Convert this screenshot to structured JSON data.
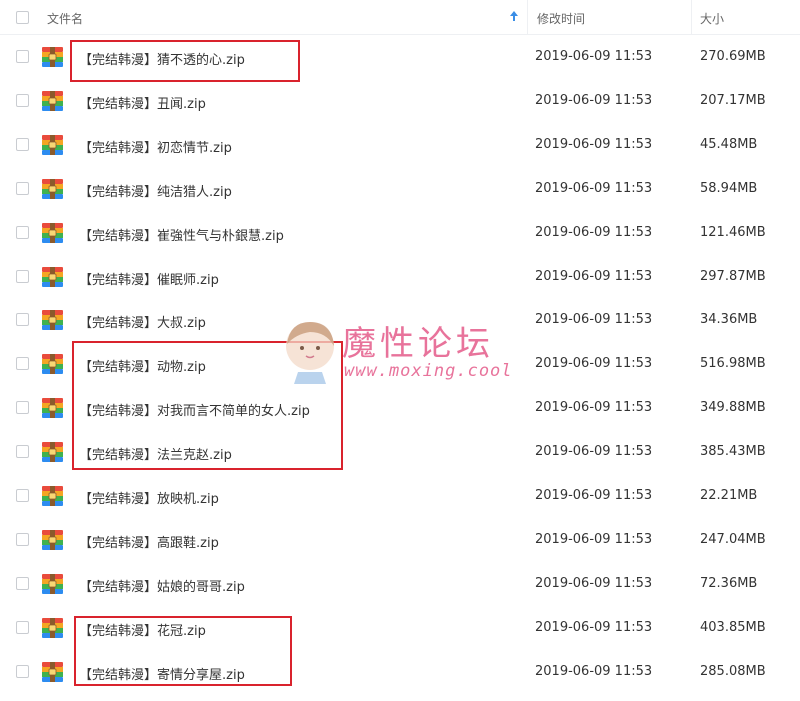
{
  "header": {
    "name_label": "文件名",
    "date_label": "修改时间",
    "size_label": "大小"
  },
  "files": [
    {
      "name": "【完结韩漫】猜不透的心.zip",
      "date": "2019-06-09 11:53",
      "size": "270.69MB"
    },
    {
      "name": "【完结韩漫】丑闻.zip",
      "date": "2019-06-09 11:53",
      "size": "207.17MB"
    },
    {
      "name": "【完结韩漫】初恋情节.zip",
      "date": "2019-06-09 11:53",
      "size": "45.48MB"
    },
    {
      "name": "【完结韩漫】纯洁猎人.zip",
      "date": "2019-06-09 11:53",
      "size": "58.94MB"
    },
    {
      "name": "【完结韩漫】崔強性气与朴銀慧.zip",
      "date": "2019-06-09 11:53",
      "size": "121.46MB"
    },
    {
      "name": "【完结韩漫】催眠师.zip",
      "date": "2019-06-09 11:53",
      "size": "297.87MB"
    },
    {
      "name": "【完结韩漫】大叔.zip",
      "date": "2019-06-09 11:53",
      "size": "34.36MB"
    },
    {
      "name": "【完结韩漫】动物.zip",
      "date": "2019-06-09 11:53",
      "size": "516.98MB"
    },
    {
      "name": "【完结韩漫】对我而言不简单的女人.zip",
      "date": "2019-06-09 11:53",
      "size": "349.88MB"
    },
    {
      "name": "【完结韩漫】法兰克赵.zip",
      "date": "2019-06-09 11:53",
      "size": "385.43MB"
    },
    {
      "name": "【完结韩漫】放映机.zip",
      "date": "2019-06-09 11:53",
      "size": "22.21MB"
    },
    {
      "name": "【完结韩漫】高跟鞋.zip",
      "date": "2019-06-09 11:53",
      "size": "247.04MB"
    },
    {
      "name": "【完结韩漫】姑娘的哥哥.zip",
      "date": "2019-06-09 11:53",
      "size": "72.36MB"
    },
    {
      "name": "【完结韩漫】花冠.zip",
      "date": "2019-06-09 11:53",
      "size": "403.85MB"
    },
    {
      "name": "【完结韩漫】寄情分享屋.zip",
      "date": "2019-06-09 11:53",
      "size": "285.08MB"
    }
  ],
  "watermark": {
    "title": "魔性论坛",
    "url": "www.moxing.cool"
  },
  "colors": {
    "highlight_box": "#d9232d",
    "watermark": "#e8739b",
    "sort_arrow": "#3a8ee6"
  },
  "icons": {
    "file_icon": "zip-archive-icon",
    "sort": "sort-ascending-arrow-icon"
  }
}
